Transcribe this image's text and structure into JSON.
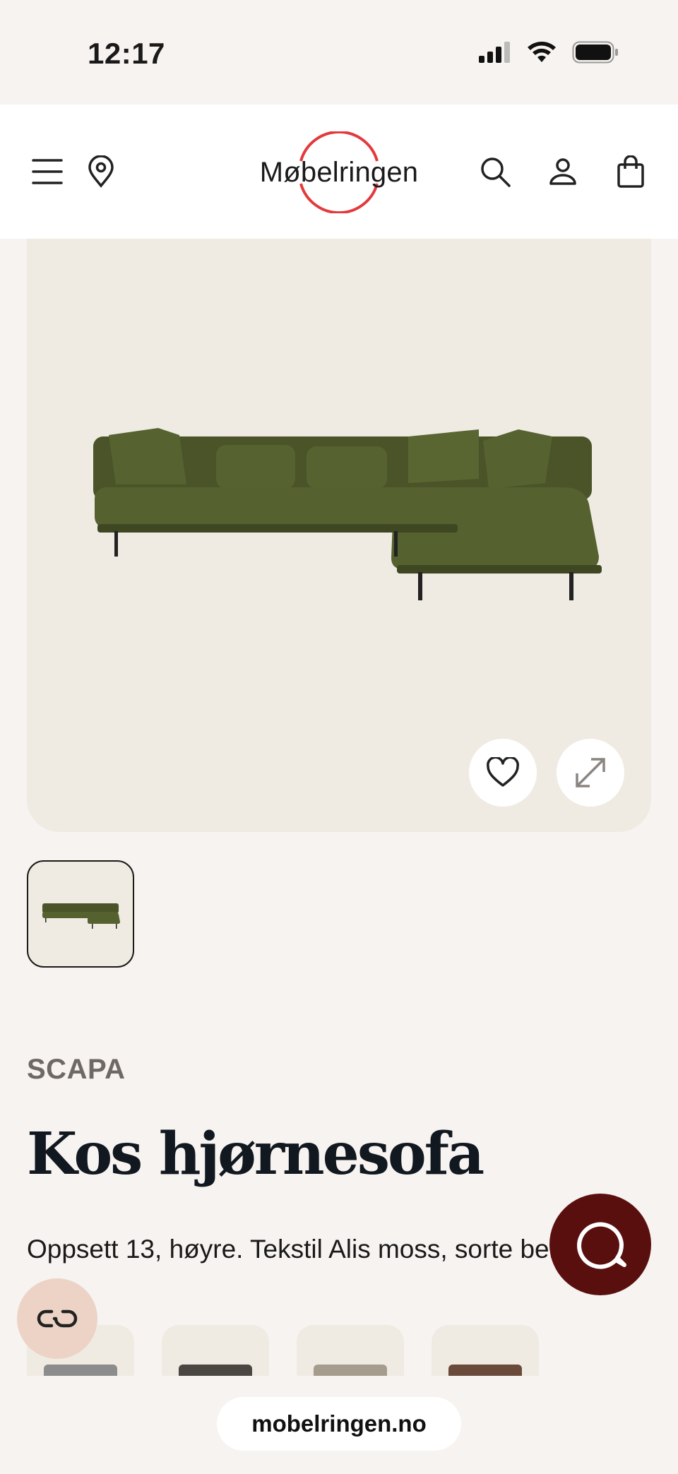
{
  "status_bar": {
    "time": "12:17"
  },
  "header": {
    "logo_text": "Møbelringen",
    "brand_color": "#e4393c"
  },
  "product": {
    "brand": "SCAPA",
    "title": "Kos hjørnesofa",
    "description": "Oppsett 13, høyre. Tekstil Alis moss, sorte ben.",
    "sofa_color": "#4f5a2c"
  },
  "swatches": [
    {
      "color": "#8c8c8c"
    },
    {
      "color": "#4a4642"
    },
    {
      "color": "#a69c8e"
    },
    {
      "color": "#6a4a3a"
    }
  ],
  "browser": {
    "url": "mobelringen.no"
  },
  "icons": {
    "menu": "menu-icon",
    "location": "location-pin-icon",
    "search": "search-icon",
    "account": "user-icon",
    "cart": "shopping-bag-icon",
    "favorite": "heart-icon",
    "expand": "expand-icon",
    "chat": "chat-icon",
    "accessibility": "accessibility-icon"
  }
}
